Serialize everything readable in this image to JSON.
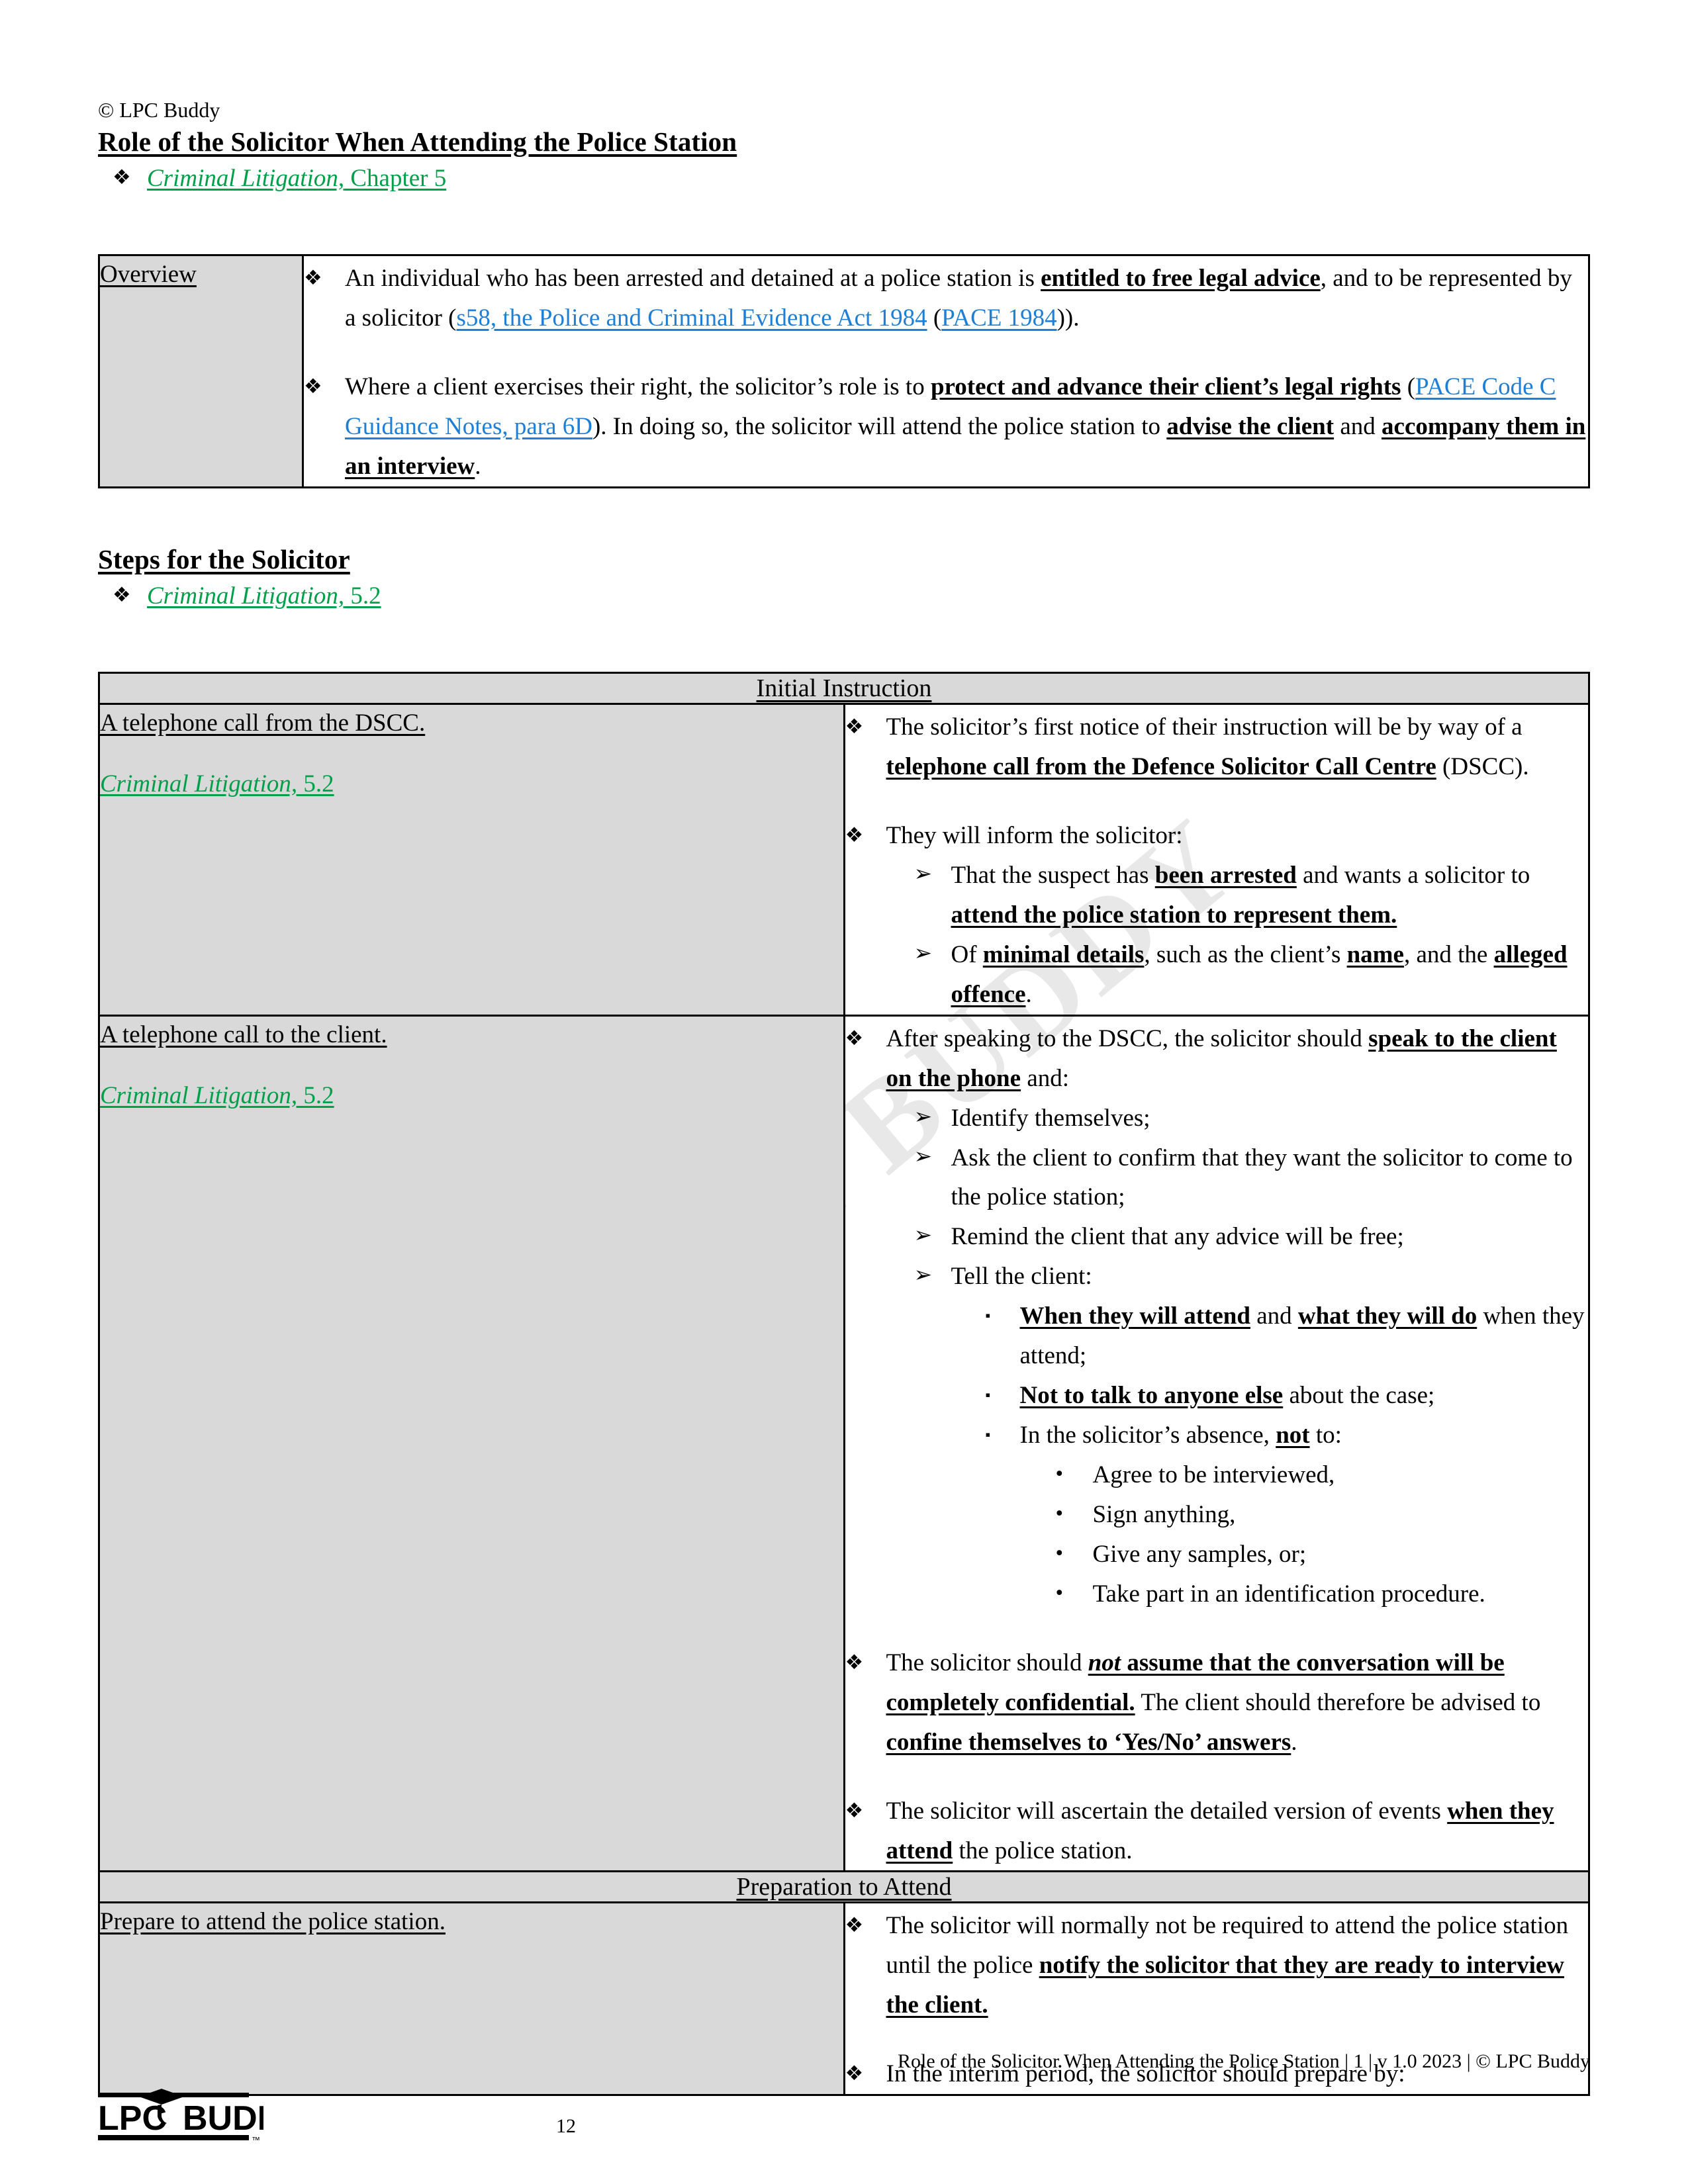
{
  "header": {
    "copyright": "© LPC Buddy",
    "title": "Role of the Solicitor When Attending the Police Station",
    "citation_italic": "Criminal Litigation,",
    "citation_plain": " Chapter 5"
  },
  "overview_table": {
    "label": "Overview",
    "bullets": [
      {
        "parts": [
          {
            "t": "An individual who has been arrested and detained at a police station is ",
            "s": "n"
          },
          {
            "t": "entitled to free legal advice",
            "s": "b"
          },
          {
            "t": ", and to be represented by a solicitor (",
            "s": "n"
          },
          {
            "t": "s58, the Police and Criminal Evidence Act 1984",
            "s": "l"
          },
          {
            "t": " (",
            "s": "n"
          },
          {
            "t": "PACE 1984",
            "s": "l"
          },
          {
            "t": ")).",
            "s": "n"
          }
        ]
      },
      {
        "parts": [
          {
            "t": "Where a client exercises their right, the solicitor’s role is to ",
            "s": "n"
          },
          {
            "t": "protect and advance their client’s legal rights",
            "s": "b"
          },
          {
            "t": " (",
            "s": "n"
          },
          {
            "t": "PACE Code C Guidance Notes, para 6D",
            "s": "l"
          },
          {
            "t": "). In doing so, the solicitor will attend the police station to ",
            "s": "n"
          },
          {
            "t": "advise the client",
            "s": "b"
          },
          {
            "t": " and ",
            "s": "n"
          },
          {
            "t": "accompany them in an interview",
            "s": "b"
          },
          {
            "t": ".",
            "s": "n"
          }
        ]
      }
    ]
  },
  "steps_heading": {
    "title": "Steps for the Solicitor",
    "citation_italic": "Criminal Litigation,",
    "citation_plain": " 5.2"
  },
  "main_table": {
    "sections": [
      {
        "type": "head",
        "title": "Initial Instruction"
      },
      {
        "type": "row",
        "label": "A telephone call from the DSCC.",
        "cite_italic": "Criminal Litigation,",
        "cite_plain": " 5.2",
        "blocks": [
          {
            "lvl": 1,
            "mk": "diamond",
            "parts": [
              {
                "t": "The solicitor’s first notice of their instruction will be by way of a ",
                "s": "n"
              },
              {
                "t": "telephone call from the Defence Solicitor Call Centre",
                "s": "b"
              },
              {
                "t": " (DSCC).",
                "s": "n"
              }
            ]
          },
          {
            "type": "gap"
          },
          {
            "lvl": 1,
            "mk": "diamond",
            "parts": [
              {
                "t": "They will inform the solicitor:",
                "s": "n"
              }
            ]
          },
          {
            "lvl": 2,
            "mk": "arrow",
            "parts": [
              {
                "t": "That the suspect has ",
                "s": "n"
              },
              {
                "t": "been arrested",
                "s": "b"
              },
              {
                "t": " and wants a solicitor to ",
                "s": "n"
              },
              {
                "t": "attend the police station to represent them.",
                "s": "b"
              }
            ]
          },
          {
            "lvl": 2,
            "mk": "arrow",
            "parts": [
              {
                "t": "Of ",
                "s": "n"
              },
              {
                "t": "minimal details",
                "s": "b"
              },
              {
                "t": ", such as the client’s ",
                "s": "n"
              },
              {
                "t": "name",
                "s": "b"
              },
              {
                "t": ", and the ",
                "s": "n"
              },
              {
                "t": "alleged offence",
                "s": "b"
              },
              {
                "t": ".",
                "s": "n"
              }
            ]
          }
        ]
      },
      {
        "type": "row",
        "label": "A telephone call to the client.",
        "cite_italic": "Criminal Litigation,",
        "cite_plain": " 5.2",
        "blocks": [
          {
            "lvl": 1,
            "mk": "diamond",
            "parts": [
              {
                "t": "After speaking to the DSCC, the solicitor should ",
                "s": "n"
              },
              {
                "t": "speak to the client on the phone",
                "s": "b"
              },
              {
                "t": " and:",
                "s": "n"
              }
            ]
          },
          {
            "lvl": 2,
            "mk": "arrow",
            "parts": [
              {
                "t": "Identify themselves;",
                "s": "n"
              }
            ]
          },
          {
            "lvl": 2,
            "mk": "arrow",
            "parts": [
              {
                "t": "Ask the client to confirm that they want the solicitor to come to the police station;",
                "s": "n"
              }
            ]
          },
          {
            "lvl": 2,
            "mk": "arrow",
            "parts": [
              {
                "t": "Remind the client that any advice will be free;",
                "s": "n"
              }
            ]
          },
          {
            "lvl": 2,
            "mk": "arrow",
            "parts": [
              {
                "t": "Tell the client:",
                "s": "n"
              }
            ]
          },
          {
            "lvl": 3,
            "mk": "square",
            "parts": [
              {
                "t": "When they will attend",
                "s": "b"
              },
              {
                "t": " and ",
                "s": "n"
              },
              {
                "t": "what they will do",
                "s": "b"
              },
              {
                "t": " when they attend;",
                "s": "n"
              }
            ]
          },
          {
            "lvl": 3,
            "mk": "square",
            "parts": [
              {
                "t": "Not to talk to anyone else",
                "s": "b"
              },
              {
                "t": " about the case;",
                "s": "n"
              }
            ]
          },
          {
            "lvl": 3,
            "mk": "square",
            "parts": [
              {
                "t": "In the solicitor’s absence, ",
                "s": "n"
              },
              {
                "t": "not",
                "s": "b"
              },
              {
                "t": " to:",
                "s": "n"
              }
            ]
          },
          {
            "lvl": 4,
            "mk": "dot",
            "parts": [
              {
                "t": "Agree to be interviewed,",
                "s": "n"
              }
            ]
          },
          {
            "lvl": 4,
            "mk": "dot",
            "parts": [
              {
                "t": "Sign anything,",
                "s": "n"
              }
            ]
          },
          {
            "lvl": 4,
            "mk": "dot",
            "parts": [
              {
                "t": "Give any samples, or;",
                "s": "n"
              }
            ]
          },
          {
            "lvl": 4,
            "mk": "dot",
            "parts": [
              {
                "t": "Take part in an identification procedure.",
                "s": "n"
              }
            ]
          },
          {
            "type": "gap"
          },
          {
            "lvl": 1,
            "mk": "diamond",
            "parts": [
              {
                "t": "The solicitor should ",
                "s": "n"
              },
              {
                "t": "not",
                "s": "i"
              },
              {
                "t": " assume that the conversation will be completely confidential.",
                "s": "b"
              },
              {
                "t": " The client should therefore be advised to ",
                "s": "n"
              },
              {
                "t": "confine themselves to ‘Yes/No’ answers",
                "s": "b"
              },
              {
                "t": ".",
                "s": "n"
              }
            ]
          },
          {
            "type": "gap"
          },
          {
            "lvl": 1,
            "mk": "diamond",
            "parts": [
              {
                "t": "The solicitor will ascertain the detailed version of events ",
                "s": "n"
              },
              {
                "t": "when they attend",
                "s": "b"
              },
              {
                "t": " the police station.",
                "s": "n"
              }
            ]
          }
        ]
      },
      {
        "type": "head",
        "title": "Preparation to Attend"
      },
      {
        "type": "row",
        "label": "Prepare to attend the police station.",
        "cite_italic": "",
        "cite_plain": "",
        "blocks": [
          {
            "lvl": 1,
            "mk": "diamond",
            "parts": [
              {
                "t": "The solicitor will normally not be required to attend the police station until the police ",
                "s": "n"
              },
              {
                "t": "notify the solicitor that they are ready to interview the client.",
                "s": "b"
              }
            ]
          },
          {
            "type": "gap"
          },
          {
            "lvl": 1,
            "mk": "diamond",
            "parts": [
              {
                "t": "In the interim period, the solicitor should prepare by:",
                "s": "n"
              }
            ]
          }
        ]
      }
    ]
  },
  "footer": {
    "line": "Role of the Solicitor When Attending the Police Station | 1 | v 1.0 2023 | © LPC Buddy",
    "page_number": "12",
    "logo_text_1": "LPC",
    "logo_text_2": "BUDDY",
    "logo_tm": "™"
  },
  "watermark": {
    "text": "LPC BUDDY"
  },
  "colors": {
    "citation_green": "#00a04b",
    "hyperlink_blue": "#1f7fd4",
    "table_shade": "#d9d9d9"
  },
  "markers": {
    "diamond": "❖",
    "arrow": "➢",
    "square": "▪",
    "dot": "•"
  }
}
